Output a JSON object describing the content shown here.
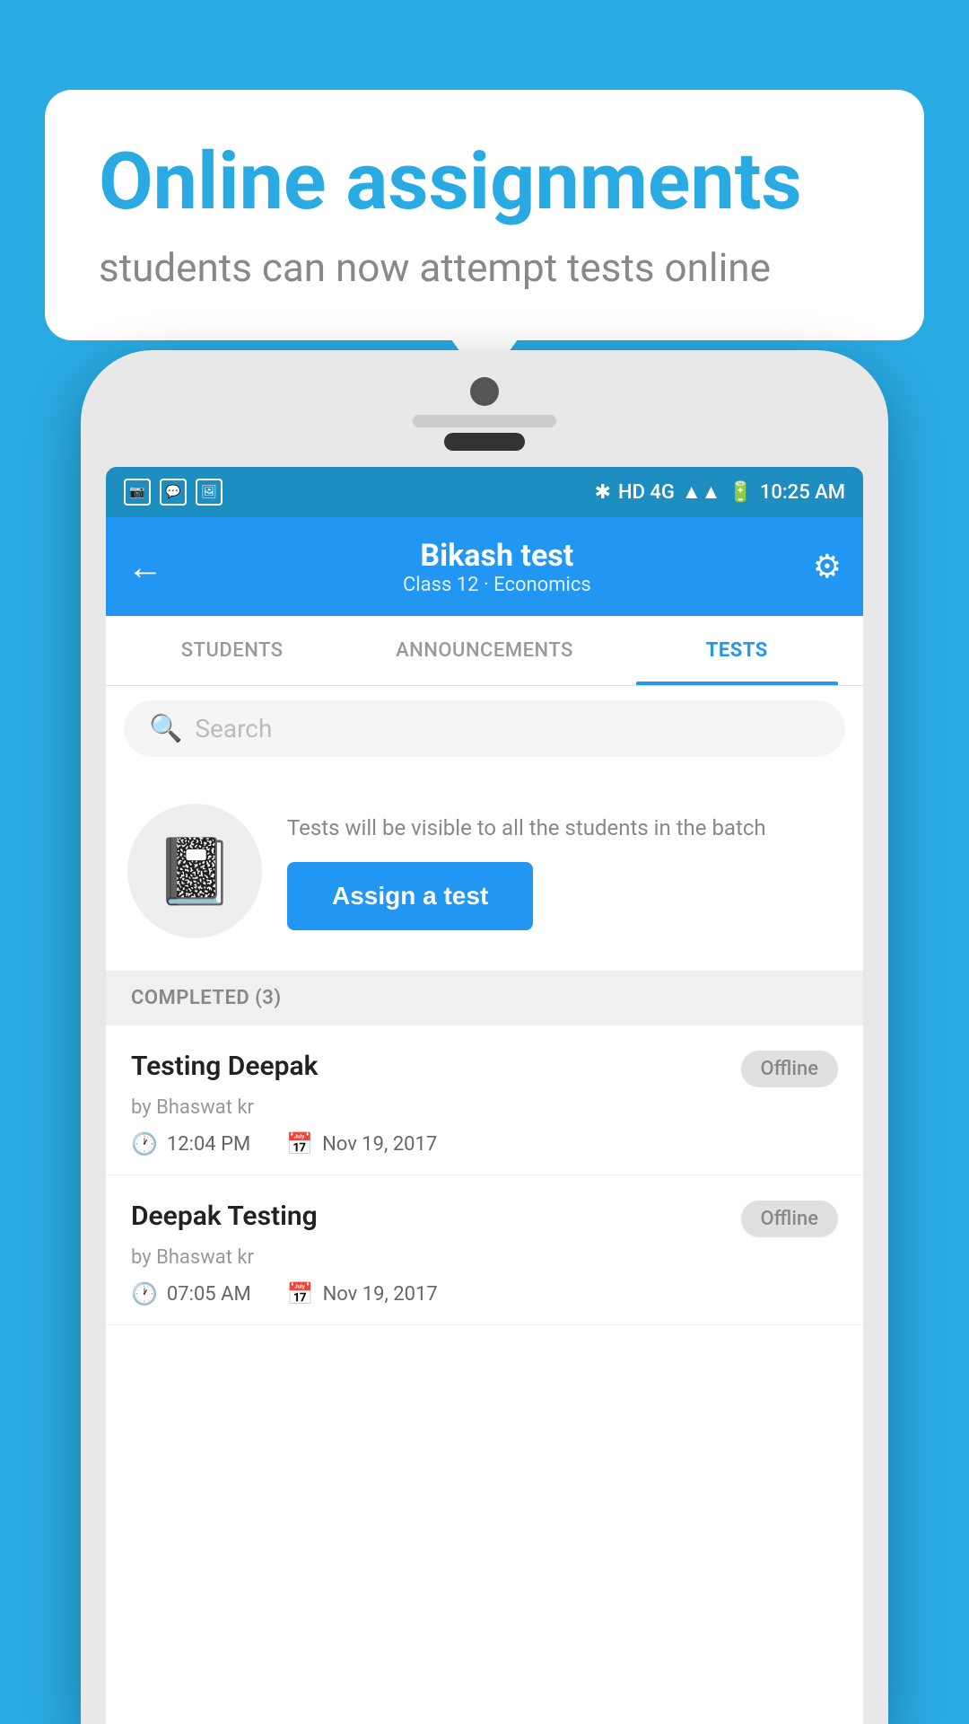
{
  "background": {
    "color": "#29aae2"
  },
  "bubble": {
    "title": "Online assignments",
    "subtitle": "students can now attempt tests online"
  },
  "status_bar": {
    "icons_left": [
      "app1",
      "whatsapp",
      "gallery"
    ],
    "bluetooth": "✱",
    "network": "HD 4G",
    "time": "10:25 AM"
  },
  "app_bar": {
    "back_label": "←",
    "title": "Bikash test",
    "subtitle": "Class 12 · Economics",
    "settings_label": "⚙"
  },
  "tabs": [
    {
      "label": "STUDENTS",
      "active": false
    },
    {
      "label": "ANNOUNCEMENTS",
      "active": false
    },
    {
      "label": "TESTS",
      "active": true
    }
  ],
  "search": {
    "placeholder": "Search"
  },
  "assign_section": {
    "description": "Tests will be visible to all the students in the batch",
    "button_label": "Assign a test"
  },
  "completed_header": "COMPLETED (3)",
  "test_items": [
    {
      "name": "Testing Deepak",
      "status": "Offline",
      "author": "by Bhaswat kr",
      "time": "12:04 PM",
      "date": "Nov 19, 2017"
    },
    {
      "name": "Deepak Testing",
      "status": "Offline",
      "author": "by Bhaswat kr",
      "time": "07:05 AM",
      "date": "Nov 19, 2017"
    }
  ]
}
